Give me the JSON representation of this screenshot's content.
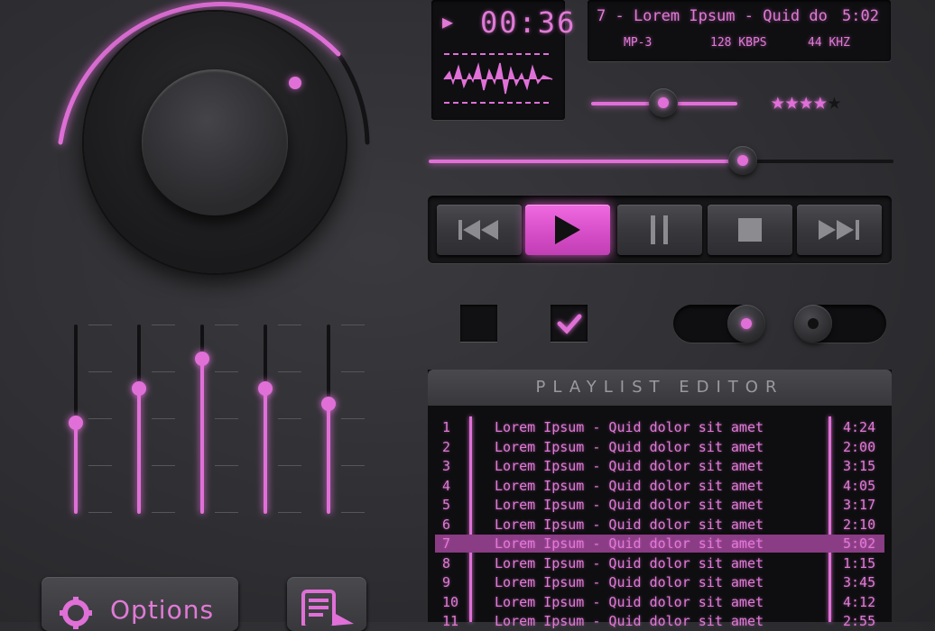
{
  "display": {
    "time": "00:36",
    "track_line": "7 - Lorem Ipsum - Quid do",
    "track_time": "5:02",
    "format": "MP-3",
    "bitrate": "128 KBPS",
    "frequency": "44 KHZ"
  },
  "small_slider": {
    "value": 0.5
  },
  "rating": {
    "filled": 4,
    "total": 5
  },
  "progress": {
    "value": 0.75
  },
  "transport": {
    "buttons": [
      "rewind",
      "play",
      "pause",
      "stop",
      "fast-forward"
    ],
    "active": "play"
  },
  "checkboxes": [
    {
      "checked": false
    },
    {
      "checked": true
    }
  ],
  "toggles": [
    {
      "on": true
    },
    {
      "on": false
    }
  ],
  "equalizer": {
    "bands": [
      0.48,
      0.66,
      0.82,
      0.66,
      0.58
    ]
  },
  "playlist": {
    "title": "PLAYLIST EDITOR",
    "selected_index": 6,
    "rows": [
      {
        "num": "1",
        "title": "Lorem Ipsum - Quid dolor sit amet",
        "time": "4:24"
      },
      {
        "num": "2",
        "title": "Lorem Ipsum - Quid dolor sit amet",
        "time": "2:00"
      },
      {
        "num": "3",
        "title": "Lorem Ipsum - Quid dolor sit amet",
        "time": "3:15"
      },
      {
        "num": "4",
        "title": "Lorem Ipsum - Quid dolor sit amet",
        "time": "4:05"
      },
      {
        "num": "5",
        "title": "Lorem Ipsum - Quid dolor sit amet",
        "time": "3:17"
      },
      {
        "num": "6",
        "title": "Lorem Ipsum - Quid dolor sit amet",
        "time": "2:10"
      },
      {
        "num": "7",
        "title": "Lorem Ipsum - Quid dolor sit amet",
        "time": "5:02"
      },
      {
        "num": "8",
        "title": "Lorem Ipsum - Quid dolor sit amet",
        "time": "1:15"
      },
      {
        "num": "9",
        "title": "Lorem Ipsum - Quid dolor sit amet",
        "time": "3:45"
      },
      {
        "num": "10",
        "title": "Lorem Ipsum - Quid dolor sit amet",
        "time": "4:12"
      },
      {
        "num": "11",
        "title": "Lorem Ipsum - Quid dolor sit amet",
        "time": "2:55"
      }
    ]
  },
  "options_button": {
    "label": "Options"
  },
  "colors": {
    "accent": "#e070d8",
    "background": "#2e2e32"
  }
}
